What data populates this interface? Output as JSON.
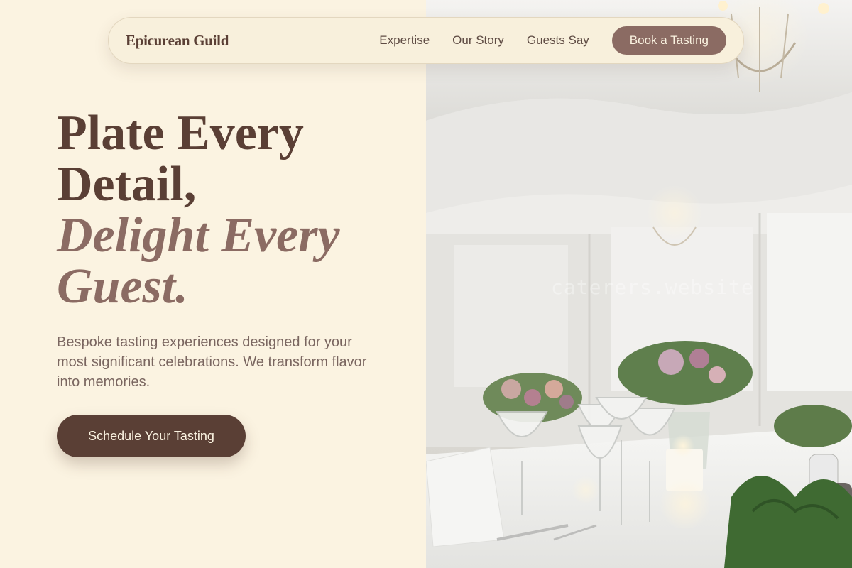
{
  "brand": "Epicurean Guild",
  "nav": {
    "links": [
      "Expertise",
      "Our Story",
      "Guests Say"
    ],
    "cta": "Book a Tasting"
  },
  "hero": {
    "headline_line1": "Plate Every Detail,",
    "headline_line2": "Delight Every Guest.",
    "lede": "Bespoke tasting experiences designed for your most significant celebrations. We transform flavor into memories.",
    "cta": "Schedule Your Tasting"
  },
  "photo": {
    "watermark": "caterers.website",
    "subject": "elegant wedding table setting with glassware, candles and floral centerpieces under a draped white marquee"
  },
  "colors": {
    "background": "#fbf3e1",
    "primary": "#5a3f35",
    "accent": "#8b6b63",
    "body_text": "#7a6660"
  }
}
